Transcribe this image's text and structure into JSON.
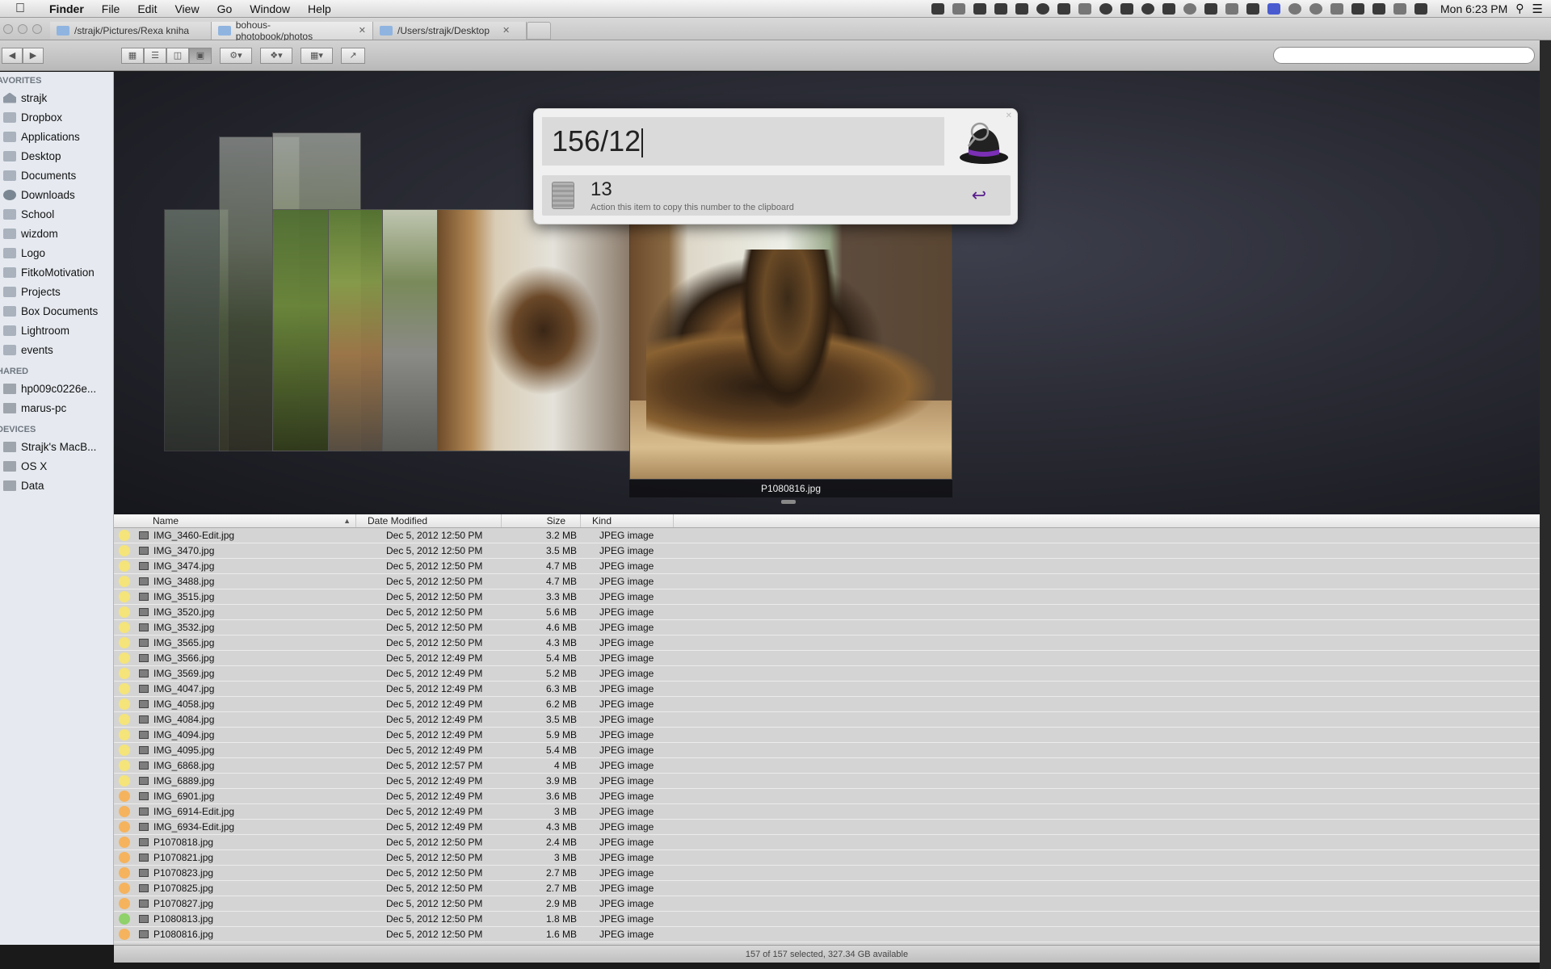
{
  "menubar": {
    "app": "Finder",
    "items": [
      "File",
      "Edit",
      "View",
      "Go",
      "Window",
      "Help"
    ],
    "clock": "Mon 6:23 PM"
  },
  "tabs": [
    {
      "label": "/strajk/Pictures/Rexa kniha"
    },
    {
      "label": "bohous-photobook/photos"
    },
    {
      "label": "/Users/strajk/Desktop"
    }
  ],
  "sidebar": {
    "favorites_header": "AVORITES",
    "favorites": [
      {
        "label": "strajk",
        "icon": "home-icon"
      },
      {
        "label": "Dropbox",
        "icon": "dropbox-icon"
      },
      {
        "label": "Applications",
        "icon": "applications-icon"
      },
      {
        "label": "Desktop",
        "icon": "desktop-icon"
      },
      {
        "label": "Documents",
        "icon": "documents-icon"
      },
      {
        "label": "Downloads",
        "icon": "downloads-icon"
      },
      {
        "label": "School",
        "icon": "folder-icon"
      },
      {
        "label": "wizdom",
        "icon": "folder-icon"
      },
      {
        "label": "Logo",
        "icon": "folder-icon"
      },
      {
        "label": "FitkoMotivation",
        "icon": "folder-icon"
      },
      {
        "label": "Projects",
        "icon": "folder-icon"
      },
      {
        "label": "Box Documents",
        "icon": "folder-icon"
      },
      {
        "label": "Lightroom",
        "icon": "folder-icon"
      },
      {
        "label": "events",
        "icon": "folder-icon"
      }
    ],
    "shared_header": "HARED",
    "shared": [
      {
        "label": "hp009c0226e...",
        "icon": "computer-icon"
      },
      {
        "label": "marus-pc",
        "icon": "computer-icon"
      }
    ],
    "devices_header": "DEVICES",
    "devices": [
      {
        "label": "Strajk's MacB...",
        "icon": "laptop-icon"
      },
      {
        "label": "OS X",
        "icon": "disk-icon"
      },
      {
        "label": "Data",
        "icon": "disk-icon"
      }
    ]
  },
  "coverflow": {
    "caption": "P1080816.jpg"
  },
  "alfred": {
    "query": "156/12",
    "result_value": "13",
    "result_subtitle": "Action this item to copy this number to the clipboard",
    "accent": "#5a1f8e"
  },
  "list": {
    "columns": {
      "name": "Name",
      "date": "Date Modified",
      "size": "Size",
      "kind": "Kind"
    },
    "rows": [
      {
        "name": "IMG_3460-Edit.jpg",
        "date": "Dec 5, 2012 12:50 PM",
        "size": "3.2 MB",
        "kind": "JPEG image",
        "label": "yellow"
      },
      {
        "name": "IMG_3470.jpg",
        "date": "Dec 5, 2012 12:50 PM",
        "size": "3.5 MB",
        "kind": "JPEG image",
        "label": "yellow"
      },
      {
        "name": "IMG_3474.jpg",
        "date": "Dec 5, 2012 12:50 PM",
        "size": "4.7 MB",
        "kind": "JPEG image",
        "label": "yellow"
      },
      {
        "name": "IMG_3488.jpg",
        "date": "Dec 5, 2012 12:50 PM",
        "size": "4.7 MB",
        "kind": "JPEG image",
        "label": "yellow"
      },
      {
        "name": "IMG_3515.jpg",
        "date": "Dec 5, 2012 12:50 PM",
        "size": "3.3 MB",
        "kind": "JPEG image",
        "label": "yellow"
      },
      {
        "name": "IMG_3520.jpg",
        "date": "Dec 5, 2012 12:50 PM",
        "size": "5.6 MB",
        "kind": "JPEG image",
        "label": "yellow"
      },
      {
        "name": "IMG_3532.jpg",
        "date": "Dec 5, 2012 12:50 PM",
        "size": "4.6 MB",
        "kind": "JPEG image",
        "label": "yellow"
      },
      {
        "name": "IMG_3565.jpg",
        "date": "Dec 5, 2012 12:50 PM",
        "size": "4.3 MB",
        "kind": "JPEG image",
        "label": "yellow"
      },
      {
        "name": "IMG_3566.jpg",
        "date": "Dec 5, 2012 12:49 PM",
        "size": "5.4 MB",
        "kind": "JPEG image",
        "label": "yellow"
      },
      {
        "name": "IMG_3569.jpg",
        "date": "Dec 5, 2012 12:49 PM",
        "size": "5.2 MB",
        "kind": "JPEG image",
        "label": "yellow"
      },
      {
        "name": "IMG_4047.jpg",
        "date": "Dec 5, 2012 12:49 PM",
        "size": "6.3 MB",
        "kind": "JPEG image",
        "label": "yellow"
      },
      {
        "name": "IMG_4058.jpg",
        "date": "Dec 5, 2012 12:49 PM",
        "size": "6.2 MB",
        "kind": "JPEG image",
        "label": "yellow"
      },
      {
        "name": "IMG_4084.jpg",
        "date": "Dec 5, 2012 12:49 PM",
        "size": "3.5 MB",
        "kind": "JPEG image",
        "label": "yellow"
      },
      {
        "name": "IMG_4094.jpg",
        "date": "Dec 5, 2012 12:49 PM",
        "size": "5.9 MB",
        "kind": "JPEG image",
        "label": "yellow"
      },
      {
        "name": "IMG_4095.jpg",
        "date": "Dec 5, 2012 12:49 PM",
        "size": "5.4 MB",
        "kind": "JPEG image",
        "label": "yellow"
      },
      {
        "name": "IMG_6868.jpg",
        "date": "Dec 5, 2012 12:57 PM",
        "size": "4 MB",
        "kind": "JPEG image",
        "label": "yellow"
      },
      {
        "name": "IMG_6889.jpg",
        "date": "Dec 5, 2012 12:49 PM",
        "size": "3.9 MB",
        "kind": "JPEG image",
        "label": "yellow"
      },
      {
        "name": "IMG_6901.jpg",
        "date": "Dec 5, 2012 12:49 PM",
        "size": "3.6 MB",
        "kind": "JPEG image",
        "label": "orange"
      },
      {
        "name": "IMG_6914-Edit.jpg",
        "date": "Dec 5, 2012 12:49 PM",
        "size": "3 MB",
        "kind": "JPEG image",
        "label": "orange"
      },
      {
        "name": "IMG_6934-Edit.jpg",
        "date": "Dec 5, 2012 12:49 PM",
        "size": "4.3 MB",
        "kind": "JPEG image",
        "label": "orange"
      },
      {
        "name": "P1070818.jpg",
        "date": "Dec 5, 2012 12:50 PM",
        "size": "2.4 MB",
        "kind": "JPEG image",
        "label": "orange"
      },
      {
        "name": "P1070821.jpg",
        "date": "Dec 5, 2012 12:50 PM",
        "size": "3 MB",
        "kind": "JPEG image",
        "label": "orange"
      },
      {
        "name": "P1070823.jpg",
        "date": "Dec 5, 2012 12:50 PM",
        "size": "2.7 MB",
        "kind": "JPEG image",
        "label": "orange"
      },
      {
        "name": "P1070825.jpg",
        "date": "Dec 5, 2012 12:50 PM",
        "size": "2.7 MB",
        "kind": "JPEG image",
        "label": "orange"
      },
      {
        "name": "P1070827.jpg",
        "date": "Dec 5, 2012 12:50 PM",
        "size": "2.9 MB",
        "kind": "JPEG image",
        "label": "orange"
      },
      {
        "name": "P1080813.jpg",
        "date": "Dec 5, 2012 12:50 PM",
        "size": "1.8 MB",
        "kind": "JPEG image",
        "label": "green"
      },
      {
        "name": "P1080816.jpg",
        "date": "Dec 5, 2012 12:50 PM",
        "size": "1.6 MB",
        "kind": "JPEG image",
        "label": "orange"
      }
    ]
  },
  "label_colors": {
    "yellow": "#f4e47a",
    "orange": "#f5b35e",
    "green": "#8fd16a"
  },
  "status": "157 of 157 selected, 327.34 GB available"
}
